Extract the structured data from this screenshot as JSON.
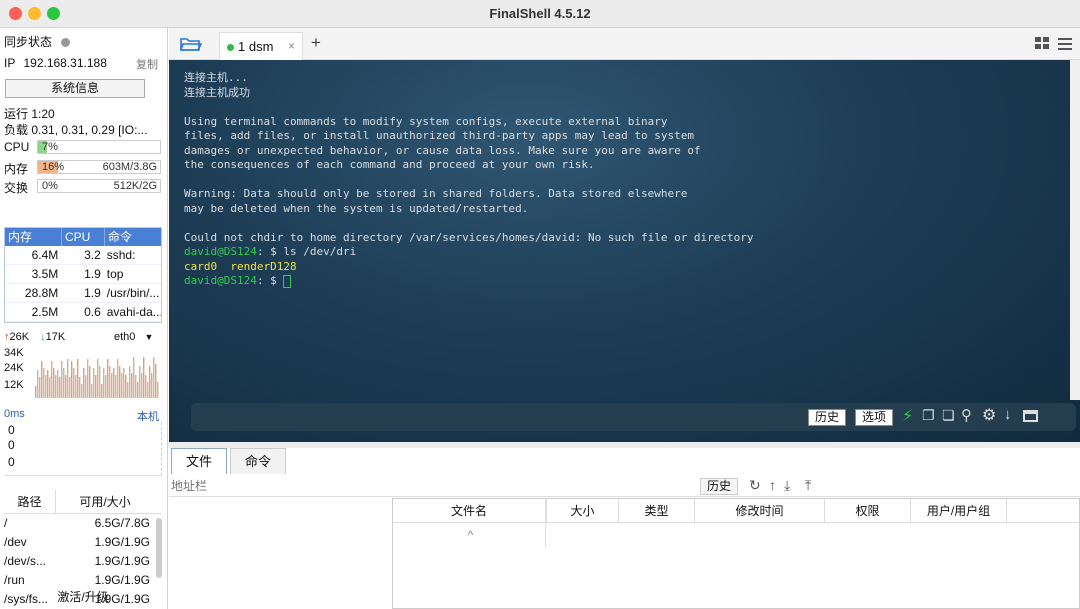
{
  "window": {
    "title": "FinalShell 4.5.12"
  },
  "sidebar": {
    "sync_label": "同步状态",
    "ip_label": "IP",
    "ip_value": "192.168.31.188",
    "copy_label": "复制",
    "sysinfo_button": "系统信息",
    "uptime": "运行 1:20",
    "load": "负载 0.31, 0.31, 0.29 [IO:...",
    "cpu": {
      "label": "CPU",
      "percent": "7%",
      "fraction": 0.07
    },
    "mem": {
      "label": "内存",
      "percent": "16%",
      "fraction": 0.16,
      "amount": "603M/3.8G"
    },
    "swap": {
      "label": "交换",
      "percent": "0%",
      "fraction": 0.0,
      "amount": "512K/2G"
    },
    "proc_headers": [
      "内存",
      "CPU",
      "命令"
    ],
    "processes": [
      {
        "mem": "6.4M",
        "cpu": "3.2",
        "cmd": "sshd:"
      },
      {
        "mem": "3.5M",
        "cpu": "1.9",
        "cmd": "top"
      },
      {
        "mem": "28.8M",
        "cpu": "1.9",
        "cmd": "/usr/bin/..."
      },
      {
        "mem": "2.5M",
        "cpu": "0.6",
        "cmd": "avahi-da..."
      }
    ],
    "net": {
      "up": "26K",
      "down": "17K",
      "interface": "eth0",
      "scale": [
        "34K",
        "24K",
        "12K"
      ]
    },
    "ping": {
      "latency": "0ms",
      "target": "本机",
      "values": [
        "0",
        "0",
        "0"
      ]
    },
    "disk_headers": [
      "路径",
      "可用/大小"
    ],
    "disks": [
      {
        "path": "/",
        "size": "6.5G/7.8G"
      },
      {
        "path": "/dev",
        "size": "1.9G/1.9G"
      },
      {
        "path": "/dev/s...",
        "size": "1.9G/1.9G"
      },
      {
        "path": "/run",
        "size": "1.9G/1.9G"
      },
      {
        "path": "/sys/fs...",
        "size": "1.9G/1.9G"
      }
    ],
    "activate_label": "激活/升级"
  },
  "tabs": {
    "active_label": "1 dsm",
    "add_label": "+"
  },
  "terminal": {
    "lines": [
      {
        "text": "连接主机...",
        "cls": ""
      },
      {
        "text": "连接主机成功",
        "cls": ""
      },
      {
        "text": "",
        "cls": ""
      },
      {
        "text": "Using terminal commands to modify system configs, execute external binary",
        "cls": ""
      },
      {
        "text": "files, add files, or install unauthorized third-party apps may lead to system",
        "cls": ""
      },
      {
        "text": "damages or unexpected behavior, or cause data loss. Make sure you are aware of",
        "cls": ""
      },
      {
        "text": "the consequences of each command and proceed at your own risk.",
        "cls": ""
      },
      {
        "text": "",
        "cls": ""
      },
      {
        "text": "Warning: Data should only be stored in shared folders. Data stored elsewhere",
        "cls": ""
      },
      {
        "text": "may be deleted when the system is updated/restarted.",
        "cls": ""
      },
      {
        "text": "",
        "cls": ""
      },
      {
        "text": "Could not chdir to home directory /var/services/homes/david: No such file or directory",
        "cls": ""
      }
    ],
    "prompt_user": "david@DS124",
    "prompt_suffix": ": $ ",
    "command": "ls /dev/dri",
    "output": "card0  renderD128",
    "history_button": "历史",
    "options_button": "选项"
  },
  "files": {
    "tab_files": "文件",
    "tab_commands": "命令",
    "address_placeholder": "地址栏",
    "history_button": "历史",
    "columns": [
      "文件名",
      "大小",
      "类型",
      "修改时间",
      "权限",
      "用户/用户组"
    ]
  }
}
